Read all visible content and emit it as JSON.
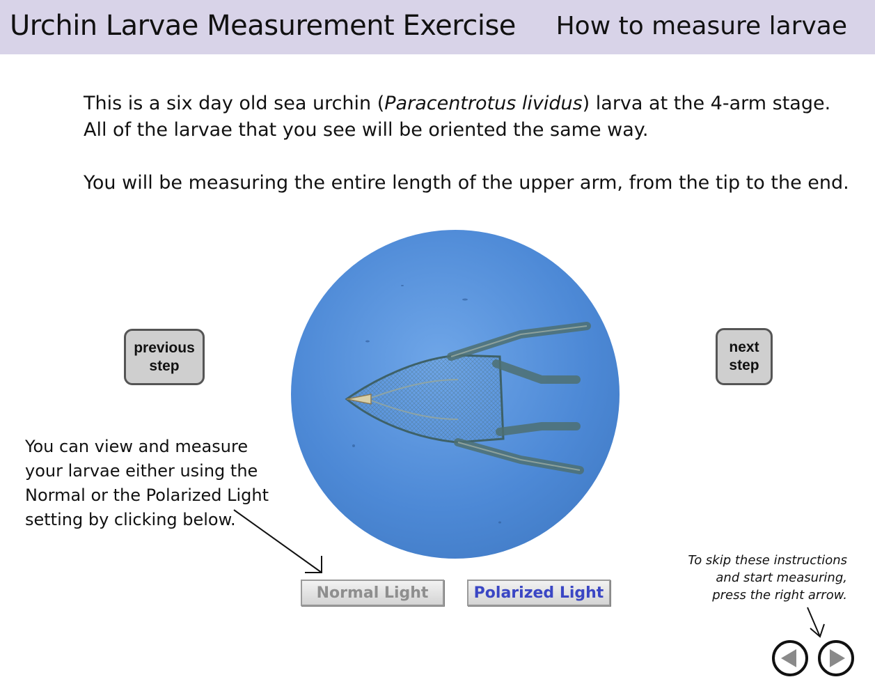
{
  "header": {
    "app_title": "Urchin Larvae Measurement Exercise",
    "section_title": "How to measure larvae"
  },
  "intro": {
    "p1_before": "This is a six day old sea urchin (",
    "p1_species": "Paracentrotus lividus",
    "p1_after": ") larva at the 4-arm stage.  All of the larvae that you see will be oriented the same way.",
    "p2": "You will be measuring the entire length of the upper arm, from the tip to the end."
  },
  "nav": {
    "previous_label": "previous\nstep",
    "next_label": "next\nstep"
  },
  "light_note": "You can view and measure your larvae either using the Normal or the Polarized Light setting by clicking below.",
  "light_buttons": {
    "normal_label": "Normal Light",
    "polarized_label": "Polarized Light"
  },
  "skip_note": {
    "line1": "To skip these instructions",
    "line2": "and start measuring,",
    "line3": "press the right arrow."
  },
  "colors": {
    "header_bg": "#d8d3e8",
    "scope_blue": "#4d89d6",
    "polarized_text": "#3a46c4",
    "normal_text": "#8e8e8e"
  },
  "icons": {
    "back": "circle-left-arrow-icon",
    "forward": "circle-right-arrow-icon"
  }
}
